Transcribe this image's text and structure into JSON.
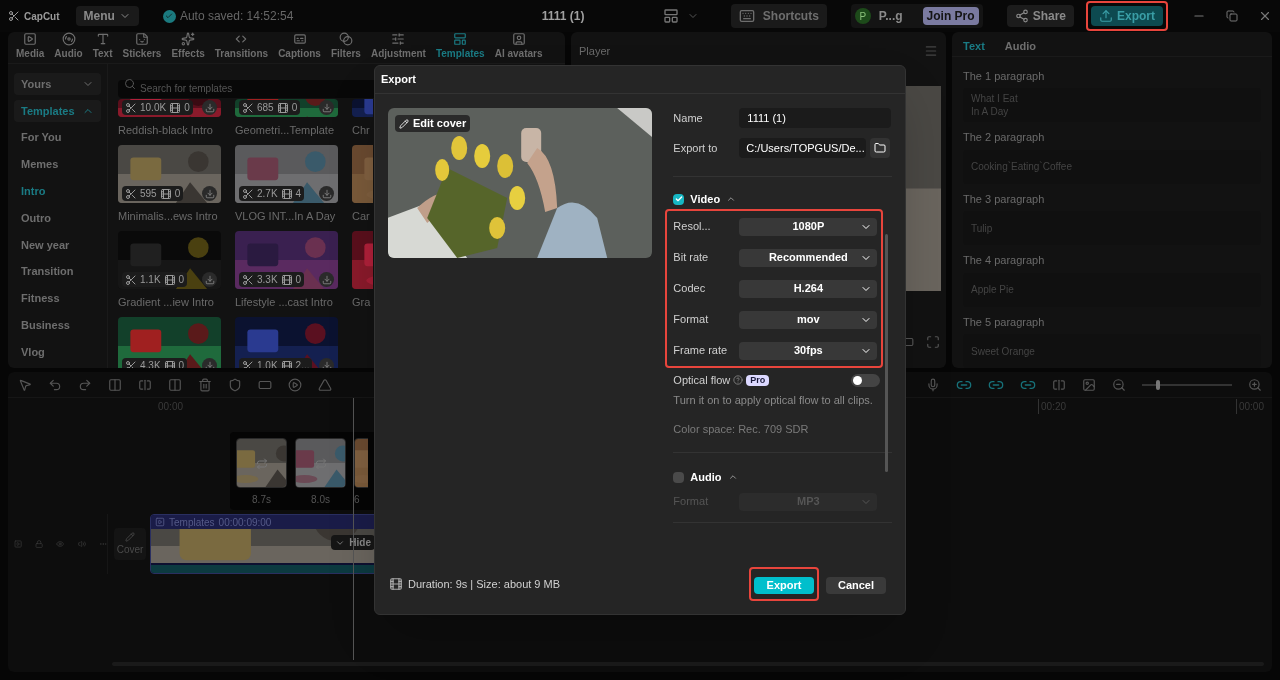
{
  "app": {
    "logo": "CapCut",
    "menu": "Menu",
    "autosave": "Auto saved: 14:52:54",
    "title": "1111 (1)",
    "shortcuts": "Shortcuts",
    "user": {
      "initial": "P",
      "name": "P...g"
    },
    "join_pro": "Join Pro",
    "share": "Share",
    "export": {
      "label": "Export",
      "highlighted": true
    }
  },
  "media_tabs": [
    {
      "label": "Media",
      "selected": false
    },
    {
      "label": "Audio",
      "selected": false
    },
    {
      "label": "Text",
      "selected": false
    },
    {
      "label": "Stickers",
      "selected": false
    },
    {
      "label": "Effects",
      "selected": false
    },
    {
      "label": "Transitions",
      "selected": false
    },
    {
      "label": "Captions",
      "selected": false
    },
    {
      "label": "Filters",
      "selected": false
    },
    {
      "label": "Adjustment",
      "selected": false
    },
    {
      "label": "Templates",
      "selected": true
    },
    {
      "label": "AI avatars",
      "selected": false
    }
  ],
  "sidebar": [
    {
      "label": "Yours",
      "kind": "group",
      "expanded": false,
      "selected": false
    },
    {
      "label": "Templates",
      "kind": "group",
      "expanded": true,
      "selected": true
    },
    {
      "label": "For You",
      "kind": "item",
      "selected": false
    },
    {
      "label": "Memes",
      "kind": "item",
      "selected": false
    },
    {
      "label": "Intro",
      "kind": "item",
      "selected": true
    },
    {
      "label": "Outro",
      "kind": "item",
      "selected": false
    },
    {
      "label": "New year",
      "kind": "item",
      "selected": false
    },
    {
      "label": "Transition",
      "kind": "item",
      "selected": false
    },
    {
      "label": "Fitness",
      "kind": "item",
      "selected": false
    },
    {
      "label": "Business",
      "kind": "item",
      "selected": false
    },
    {
      "label": "Vlog",
      "kind": "item",
      "selected": false
    }
  ],
  "search": {
    "placeholder": "Search for templates"
  },
  "templates": [
    {
      "title": "Reddish-black Intro",
      "uses": "10.0K",
      "clips": "0"
    },
    {
      "title": "Geometri...Template",
      "uses": "685",
      "clips": "0"
    },
    {
      "title": "Chr"
    },
    {
      "title": "Minimalis...ews Intro",
      "uses": "595",
      "clips": "0"
    },
    {
      "title": "VLOG INT...In A Day",
      "uses": "2.7K",
      "clips": "4"
    },
    {
      "title": "Car"
    },
    {
      "title": "Gradient ...iew Intro",
      "uses": "1.1K",
      "clips": "0"
    },
    {
      "title": "Lifestyle ...cast Intro",
      "uses": "3.3K",
      "clips": "0"
    },
    {
      "title": "Gra"
    },
    {
      "uses": "4.3K",
      "clips": "0"
    },
    {
      "uses": "1.0K",
      "clips": "2..."
    }
  ],
  "player": {
    "title": "Player"
  },
  "right_tabs": [
    {
      "label": "Text",
      "selected": true
    },
    {
      "label": "Audio",
      "selected": false
    }
  ],
  "paragraphs": [
    {
      "label": "The 1 paragraph",
      "text": "What I Eat\n In A Day"
    },
    {
      "label": "The 2 paragraph",
      "text": "Cooking`Eating`Coffee"
    },
    {
      "label": "The 3 paragraph",
      "text": "Tulip"
    },
    {
      "label": "The 4 paragraph",
      "text": "Apple Pie"
    },
    {
      "label": "The 5 paragraph",
      "text": "Sweet Orange"
    }
  ],
  "timeline": {
    "ruler": [
      "00:00",
      "00:20",
      "00:00"
    ],
    "zoom": {
      "level": 0.15
    },
    "cover": "Cover",
    "durations": [
      "8.7s",
      "8.0s",
      "6"
    ],
    "clip": {
      "label": "Templates",
      "time": "00:00:09:00",
      "hide": "Hide"
    }
  },
  "export_dialog": {
    "title": "Export",
    "edit_cover": "Edit cover",
    "name": {
      "label": "Name",
      "value": "1111 (1)"
    },
    "export_to": {
      "label": "Export to",
      "value": "C:/Users/TOPGUS/De..."
    },
    "video": {
      "label": "Video",
      "checked": true,
      "expanded": true
    },
    "settings_highlighted": true,
    "settings": [
      {
        "label": "Resol...",
        "value": "1080P"
      },
      {
        "label": "Bit rate",
        "value": "Recommended"
      },
      {
        "label": "Codec",
        "value": "H.264"
      },
      {
        "label": "Format",
        "value": "mov"
      },
      {
        "label": "Frame rate",
        "value": "30fps"
      }
    ],
    "optical_flow": {
      "label": "Optical flow",
      "badge": "Pro",
      "on": false
    },
    "hint": "Turn it on to apply optical flow to all clips.",
    "color_space": "Color space: Rec. 709 SDR",
    "audio": {
      "label": "Audio",
      "checked": false,
      "expanded": true
    },
    "audio_settings": [
      {
        "label": "Format",
        "value": "MP3",
        "disabled": true
      }
    ],
    "footer": "Duration: 9s | Size: about 9 MB",
    "buttons": [
      {
        "label": "Export",
        "kind": "primary",
        "highlighted": true
      },
      {
        "label": "Cancel",
        "kind": "secondary",
        "highlighted": false
      }
    ]
  }
}
